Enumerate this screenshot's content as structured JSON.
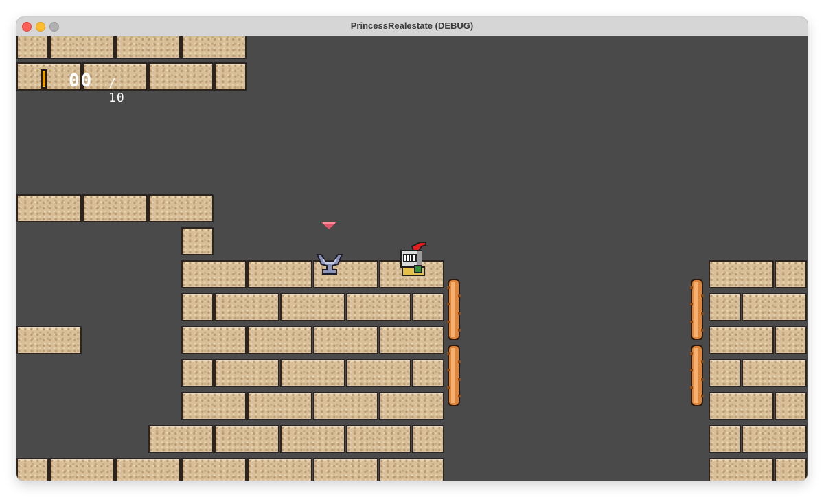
{
  "window": {
    "title": "PrincessRealestate (DEBUG)",
    "background": "#4a4a4a"
  },
  "hud": {
    "coin_icon": "coin-icon",
    "coins_collected": "00",
    "coins_total": "/ 10"
  },
  "scene": {
    "objects": [
      {
        "name": "exit-marker",
        "icon": "down-triangle-marker",
        "color": "#e0546a"
      },
      {
        "name": "anvil",
        "icon": "anvil-icon"
      },
      {
        "name": "player-knight",
        "icon": "knight-icon"
      },
      {
        "name": "spring-pad",
        "icon": "spring-icon"
      }
    ],
    "colors": {
      "brick": "#d8bf98",
      "brick_outline": "#2b2420",
      "coin": "#f6c200",
      "spring": "#e0863a"
    }
  }
}
